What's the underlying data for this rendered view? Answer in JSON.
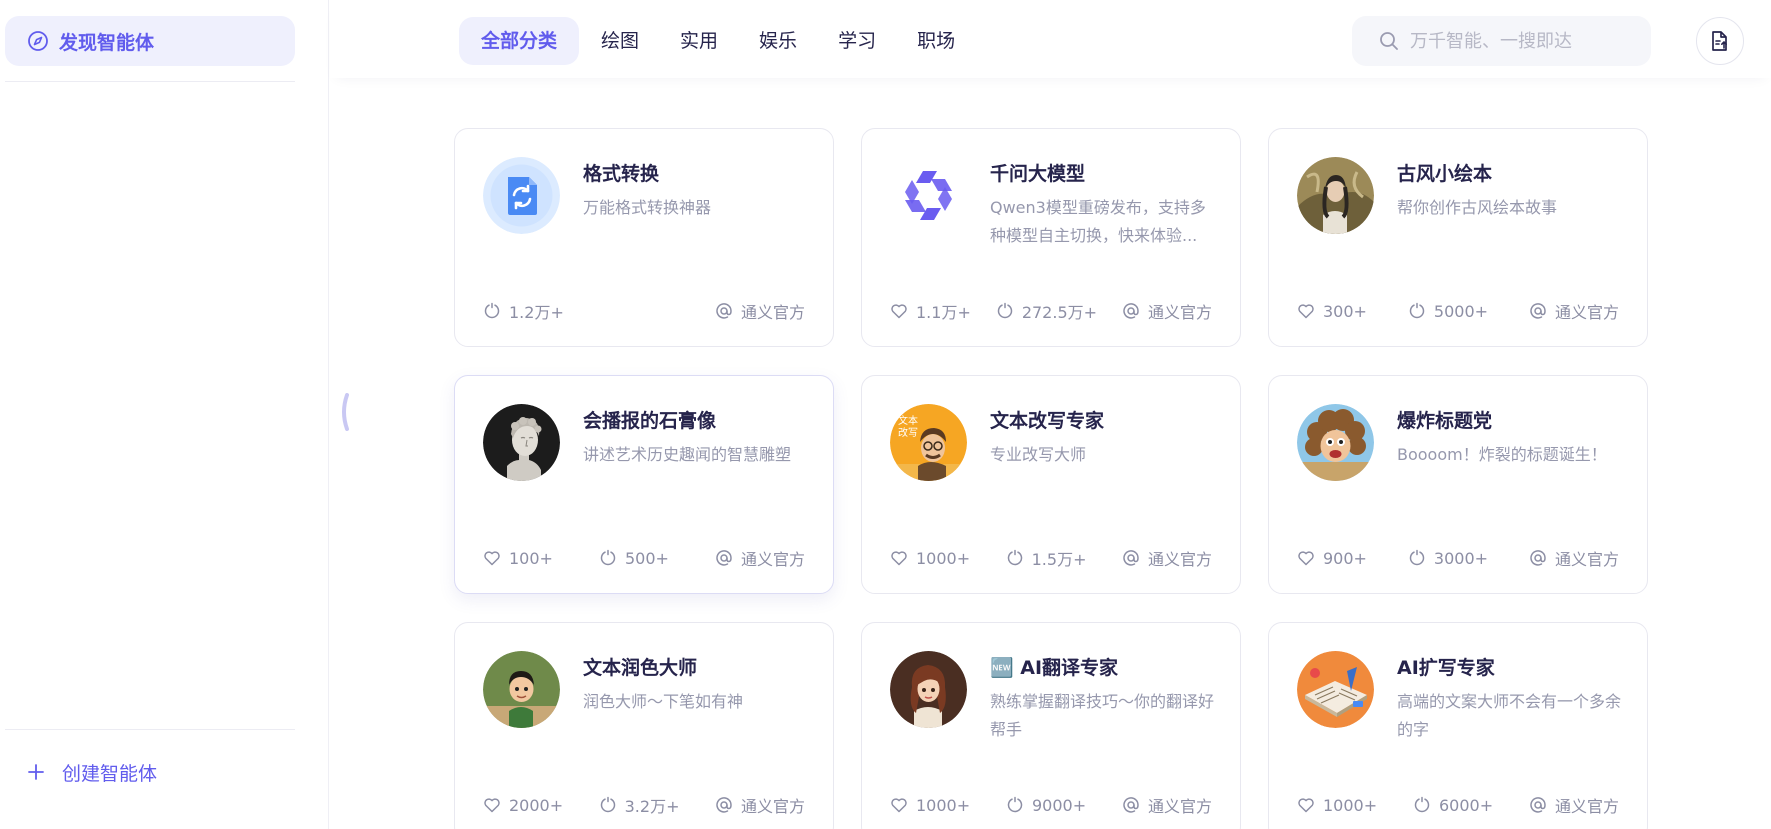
{
  "sidebar": {
    "active_item": "发现智能体",
    "create_label": "创建智能体"
  },
  "header": {
    "tabs": [
      "全部分类",
      "绘图",
      "实用",
      "娱乐",
      "学习",
      "职场"
    ],
    "active_tab": 0,
    "search_placeholder": "万千智能、一搜即达"
  },
  "colors": {
    "accent": "#615ced",
    "accent_bg": "#eff0fd",
    "muted_text": "#9698ad"
  },
  "cards": [
    {
      "title": "格式转换",
      "desc": "万能格式转换神器",
      "likes": null,
      "uses": "1.2万+",
      "author": "通义官方",
      "avatar": "file-convert-icon"
    },
    {
      "title": "千问大模型",
      "desc": "Qwen3模型重磅发布，支持多种模型自主切换，快来体验...",
      "likes": "1.1万+",
      "uses": "272.5万+",
      "author": "通义官方",
      "avatar": "qwen-logo"
    },
    {
      "title": "古风小绘本",
      "desc": "帮你创作古风绘本故事",
      "likes": "300+",
      "uses": "5000+",
      "author": "通义官方",
      "avatar": "ancient-style-portrait"
    },
    {
      "title": "会播报的石膏像",
      "desc": "讲述艺术历史趣闻的智慧雕塑",
      "likes": "100+",
      "uses": "500+",
      "author": "通义官方",
      "avatar": "plaster-statue-portrait"
    },
    {
      "title": "文本改写专家",
      "desc": "专业改写大师",
      "likes": "1000+",
      "uses": "1.5万+",
      "author": "通义官方",
      "avatar": "rewrite-expert-portrait",
      "avatar_text": "文本改写"
    },
    {
      "title": "爆炸标题党",
      "desc": "Boooom！炸裂的标题诞生！",
      "likes": "900+",
      "uses": "3000+",
      "author": "通义官方",
      "avatar": "explosion-hair-portrait"
    },
    {
      "title": "文本润色大师",
      "desc": "润色大师～下笔如有神",
      "likes": "2000+",
      "uses": "3.2万+",
      "author": "通义官方",
      "avatar": "polish-master-portrait"
    },
    {
      "title": "🆕 AI翻译专家",
      "desc": "熟练掌握翻译技巧～你的翻译好帮手",
      "likes": "1000+",
      "uses": "9000+",
      "author": "通义官方",
      "avatar": "translator-portrait"
    },
    {
      "title": "AI扩写专家",
      "desc": "高端的文案大师不会有一个多余的字",
      "likes": "1000+",
      "uses": "6000+",
      "author": "通义官方",
      "avatar": "expand-writer-portrait"
    }
  ]
}
